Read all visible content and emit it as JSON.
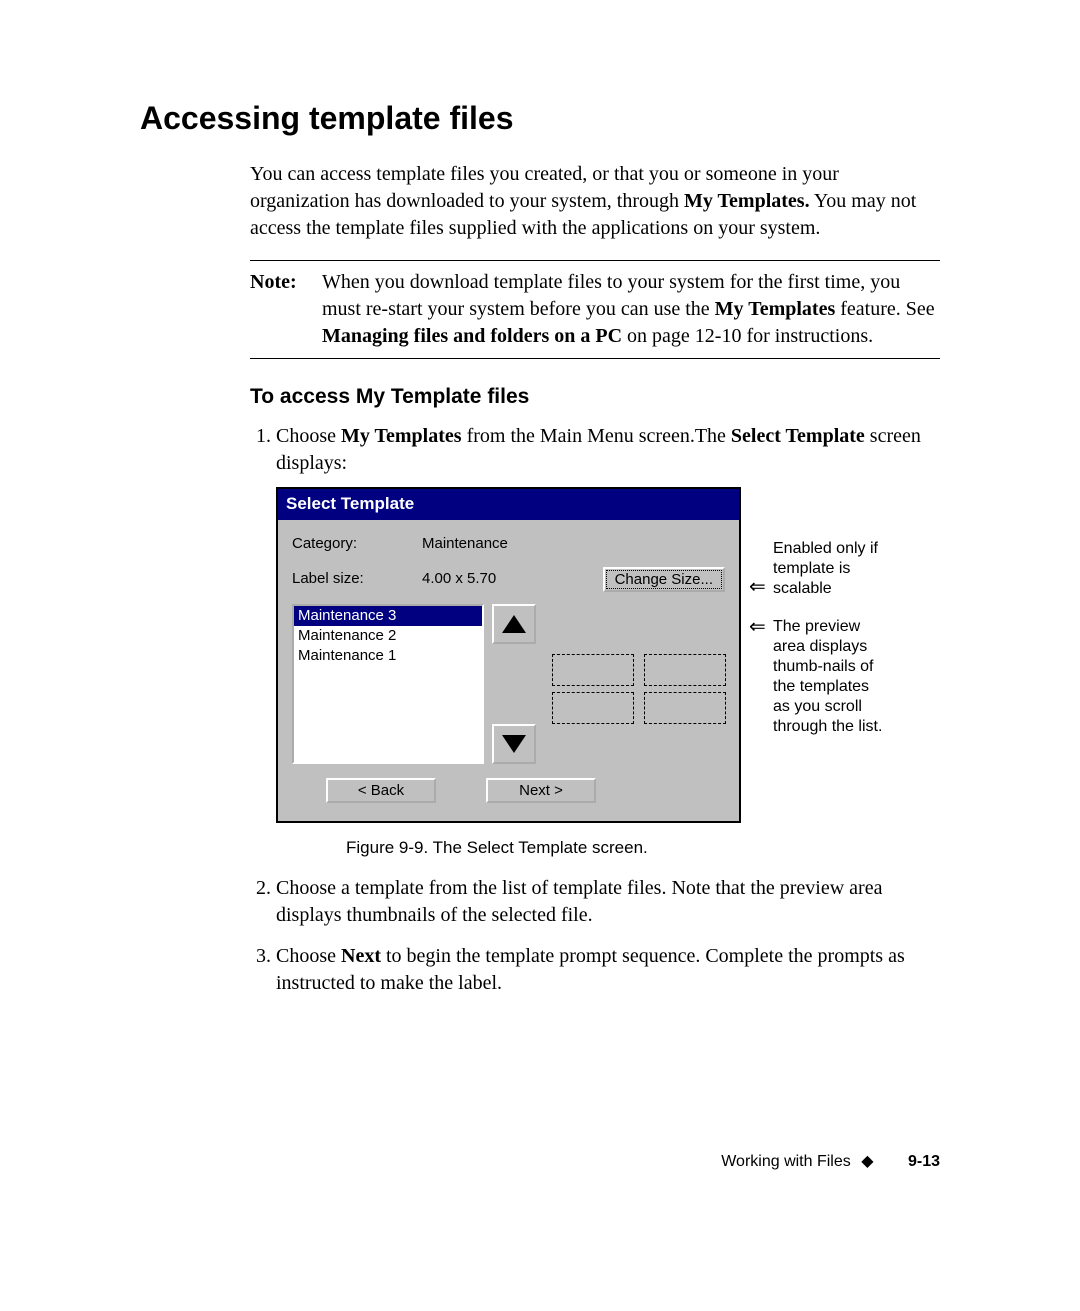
{
  "heading": "Accessing template files",
  "intro": {
    "pre": "You can access template files you created, or that you or someone in your organization has downloaded to your system, through ",
    "bold": "My Templates.",
    "post": " You may not access the template files supplied with the applications on your system."
  },
  "note": {
    "label": "Note:",
    "line1_pre": "When you download template files to your system for the first time, you must re-start your system before you can use the ",
    "line1_bold": "My Templates",
    "line1_post": " feature. See ",
    "line2_bold": "Managing files and folders on a PC",
    "line2_post": " on page 12-10 for instructions."
  },
  "subhead": "To access My Template files",
  "step1": {
    "pre": "Choose ",
    "bold1": "My Templates",
    "mid": " from the Main Menu screen.The ",
    "bold2": "Select Template",
    "post": " screen displays:"
  },
  "dialog": {
    "title": "Select Template",
    "category_label": "Category:",
    "category_value": "Maintenance",
    "size_label": "Label size:",
    "size_value": "4.00 x 5.70",
    "change_size": "Change Size...",
    "list": [
      "Maintenance 3",
      "Maintenance 2",
      "Maintenance 1"
    ],
    "back": "< Back",
    "next": "Next >"
  },
  "annotations": {
    "a1": "Enabled only if template is scalable",
    "a2": "The preview area displays thumb-nails of the templates as you scroll through the list."
  },
  "caption": "Figure 9-9. The Select Template screen.",
  "step2": "Choose a template from the list of template files. Note that the preview area displays thumbnails of the selected file.",
  "step3": {
    "pre": "Choose ",
    "bold": "Next",
    "post": " to begin the template prompt sequence. Complete the prompts as instructed to make the label."
  },
  "footer": {
    "section": "Working with Files",
    "page": "9-13"
  }
}
